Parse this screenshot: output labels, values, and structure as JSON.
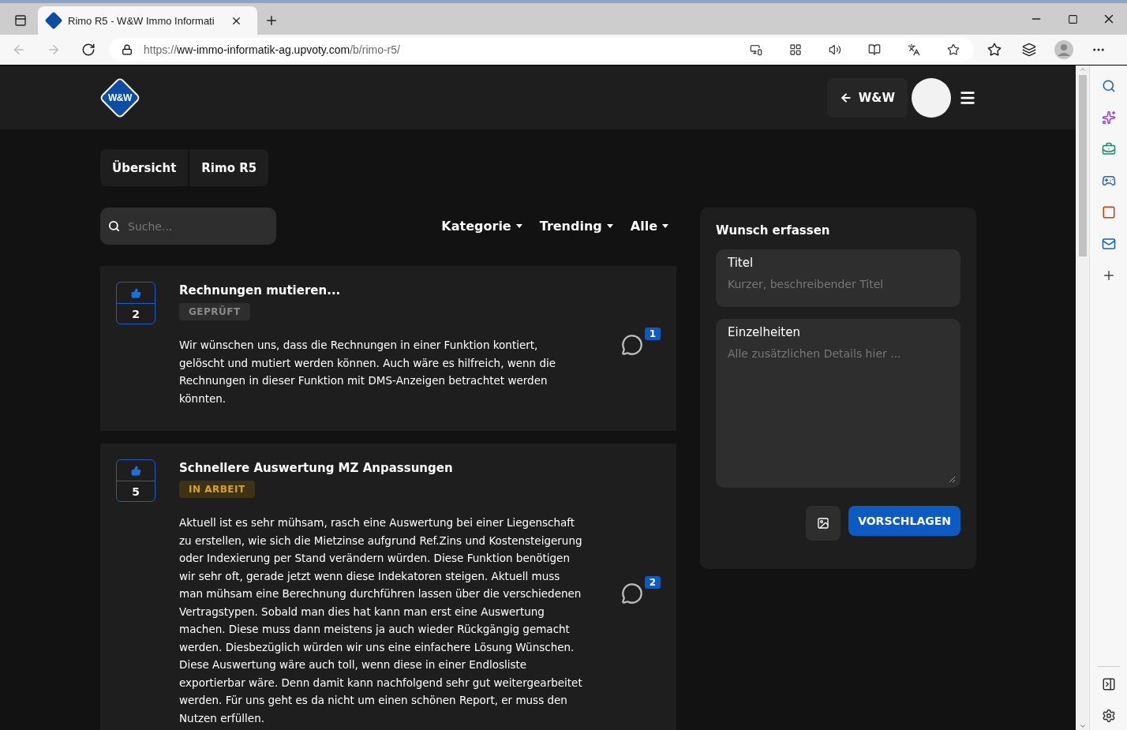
{
  "browser": {
    "tab": {
      "title": "Rimo R5 - W&W Immo Informati"
    },
    "address": {
      "scheme": "https://",
      "host": "ww-immo-informatik-ag.upvoty.com",
      "path": "/b/rimo-r5/"
    }
  },
  "header": {
    "logo_text": "W&W",
    "back_button": "W&W"
  },
  "breadcrumbs": [
    {
      "label": "Übersicht"
    },
    {
      "label": "Rimo R5"
    }
  ],
  "search": {
    "placeholder": "Suche..."
  },
  "filters": [
    {
      "label": "Kategorie"
    },
    {
      "label": "Trending"
    },
    {
      "label": "Alle"
    }
  ],
  "posts": [
    {
      "votes": "2",
      "title": "Rechnungen mutieren...",
      "status": {
        "label": "GEPRÜFT",
        "kind": "reviewed"
      },
      "body": "Wir wünschen uns, dass die Rechnungen in einer Funktion kontiert, gelöscht und mutiert werden können. Auch wäre es hilfreich, wenn die Rechnungen in dieser Funktion mit DMS-Anzeigen betrachtet werden könnten.",
      "comments": "1"
    },
    {
      "votes": "5",
      "title": "Schnellere Auswertung MZ Anpassungen",
      "status": {
        "label": "IN ARBEIT",
        "kind": "in_progress"
      },
      "body": "Aktuell ist es sehr mühsam, rasch eine Auswertung bei einer Liegenschaft zu erstellen, wie sich die Mietzinse aufgrund Ref.Zins und Kostensteigerung oder Indexierung per Stand verändern würden. Diese Funktion benötigen wir sehr oft, gerade jetzt wenn diese Indekatoren steigen. Aktuell muss man mühsam eine Berechnung durchführen lassen über die verschiedenen Vertragstypen. Sobald man dies hat kann man erst eine Auswertung machen. Diese muss dann meistens ja auch wieder Rückgängig gemacht werden. Diesbezüglich würden wir uns eine einfachere Lösung Wünschen. Diese Auswertung wäre auch toll, wenn diese in einer Endlosliste exportierbar wäre. Denn damit kann nachfolgend sehr gut weitergearbeitet werden. Für uns geht es da nicht um einen schönen Report, er muss den Nutzen erfüllen.",
      "comments": "2"
    }
  ],
  "form": {
    "heading": "Wunsch erfassen",
    "title_field": {
      "label": "Titel",
      "placeholder": "Kurzer, beschreibender Titel"
    },
    "details_field": {
      "label": "Einzelheiten",
      "placeholder": "Alle zusätzlichen Details hier ..."
    },
    "submit": "VORSCHLAGEN"
  }
}
